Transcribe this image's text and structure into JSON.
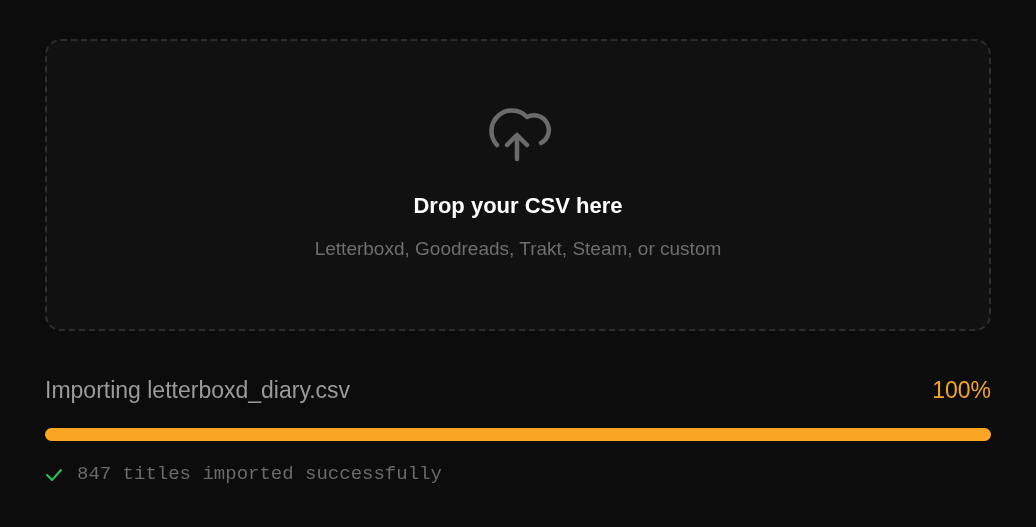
{
  "dropzone": {
    "title": "Drop your CSV here",
    "subtitle": "Letterboxd, Goodreads, Trakt, Steam, or custom"
  },
  "import": {
    "label": "Importing letterboxd_diary.csv",
    "percent": "100%",
    "level": 1
  },
  "status": {
    "success": true,
    "text": "847 titles imported successfully"
  }
}
